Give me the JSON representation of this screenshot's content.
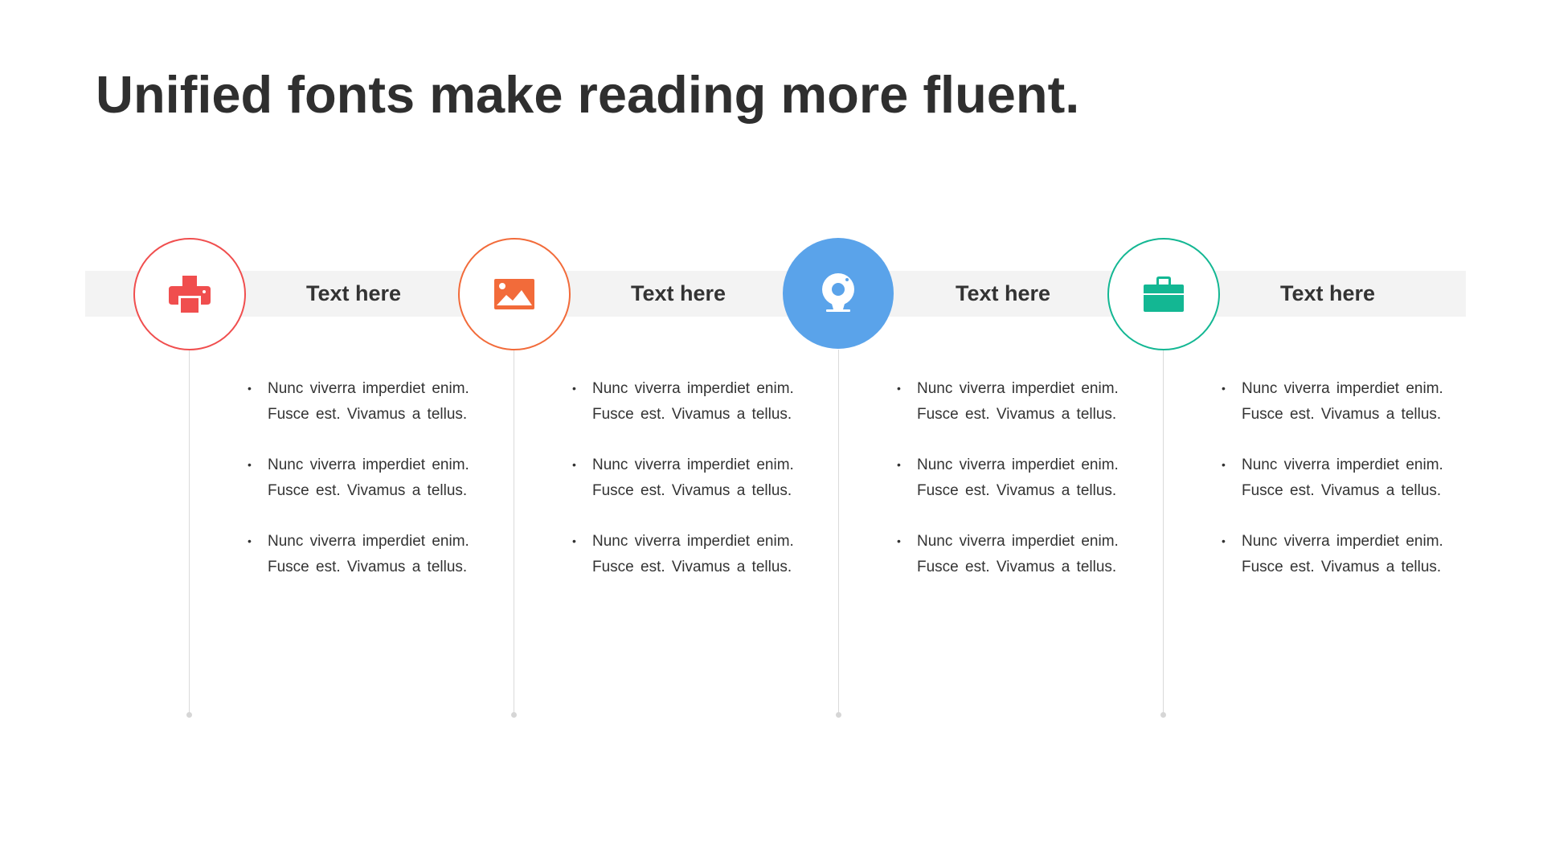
{
  "slide": {
    "title": "Unified fonts make reading more fluent."
  },
  "steps": [
    {
      "heading": "Text here",
      "icon": "printer-icon",
      "color": "#f04e4e",
      "filled": false,
      "bullets": [
        {
          "line1": "Nunc viverra imperdiet enim.",
          "line2": "Fusce est. Vivamus a tellus."
        },
        {
          "line1": "Nunc viverra imperdiet enim.",
          "line2": "Fusce est. Vivamus a tellus."
        },
        {
          "line1": "Nunc viverra imperdiet enim.",
          "line2": "Fusce est. Vivamus a tellus."
        }
      ]
    },
    {
      "heading": "Text here",
      "icon": "image-icon",
      "color": "#f26b3a",
      "filled": false,
      "bullets": [
        {
          "line1": "Nunc viverra imperdiet enim.",
          "line2": "Fusce est. Vivamus a tellus."
        },
        {
          "line1": "Nunc viverra imperdiet enim.",
          "line2": "Fusce est. Vivamus a tellus."
        },
        {
          "line1": "Nunc viverra imperdiet enim.",
          "line2": "Fusce est. Vivamus a tellus."
        }
      ]
    },
    {
      "heading": "Text here",
      "icon": "webcam-icon",
      "color": "#5aa3ea",
      "filled": true,
      "bullets": [
        {
          "line1": "Nunc viverra imperdiet enim.",
          "line2": "Fusce est. Vivamus a tellus."
        },
        {
          "line1": "Nunc viverra imperdiet enim.",
          "line2": "Fusce est. Vivamus a tellus."
        },
        {
          "line1": "Nunc viverra imperdiet enim.",
          "line2": "Fusce est. Vivamus a tellus."
        }
      ]
    },
    {
      "heading": "Text here",
      "icon": "toolbox-icon",
      "color": "#13b793",
      "filled": false,
      "bullets": [
        {
          "line1": "Nunc viverra imperdiet enim.",
          "line2": "Fusce est. Vivamus a tellus."
        },
        {
          "line1": "Nunc viverra imperdiet enim.",
          "line2": "Fusce est. Vivamus a tellus."
        },
        {
          "line1": "Nunc viverra imperdiet enim.",
          "line2": "Fusce est. Vivamus a tellus."
        }
      ]
    }
  ],
  "colors": {
    "text": "#333333",
    "band": "#f3f3f3",
    "line": "#dadada"
  }
}
